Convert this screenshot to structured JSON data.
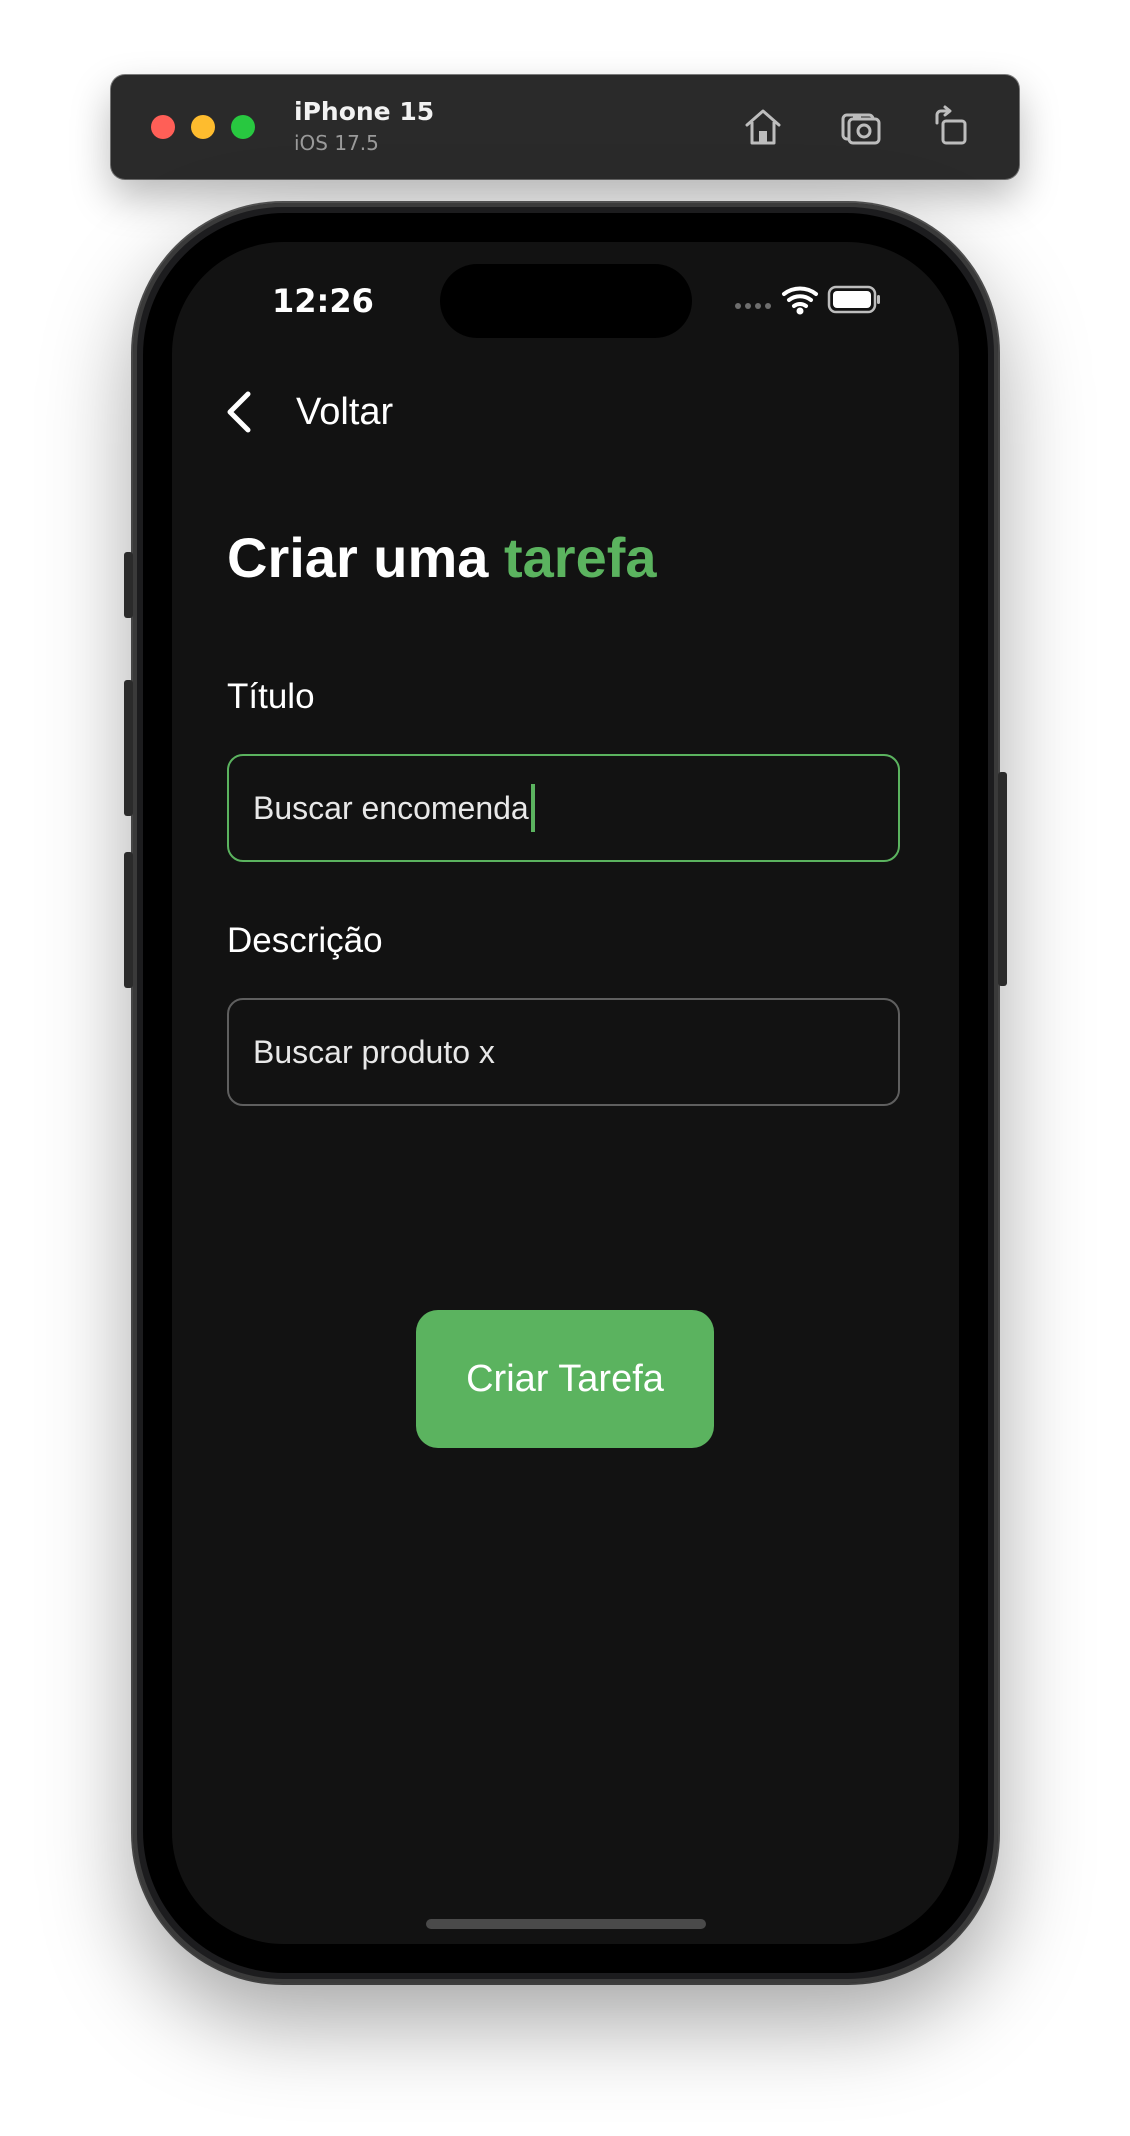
{
  "simulator": {
    "device_name": "iPhone 15",
    "os_version": "iOS 17.5",
    "toolbar_icons": [
      "home-icon",
      "screenshot-icon",
      "rotate-icon"
    ]
  },
  "status_bar": {
    "time": "12:26",
    "icons": [
      "cellular-icon",
      "wifi-icon",
      "battery-icon"
    ]
  },
  "nav": {
    "back_label": "Voltar",
    "back_icon": "chevron-left-icon"
  },
  "page": {
    "title_prefix": "Criar uma",
    "title_accent": "tarefa"
  },
  "form": {
    "title_label": "Título",
    "title_value": "Buscar encomenda",
    "description_label": "Descrição",
    "description_value": "Buscar produto x",
    "submit_label": "Criar Tarefa"
  },
  "colors": {
    "accent": "#5bb35f",
    "background": "#121212",
    "text": "#ffffff",
    "input_border": "#5f5f5f"
  }
}
